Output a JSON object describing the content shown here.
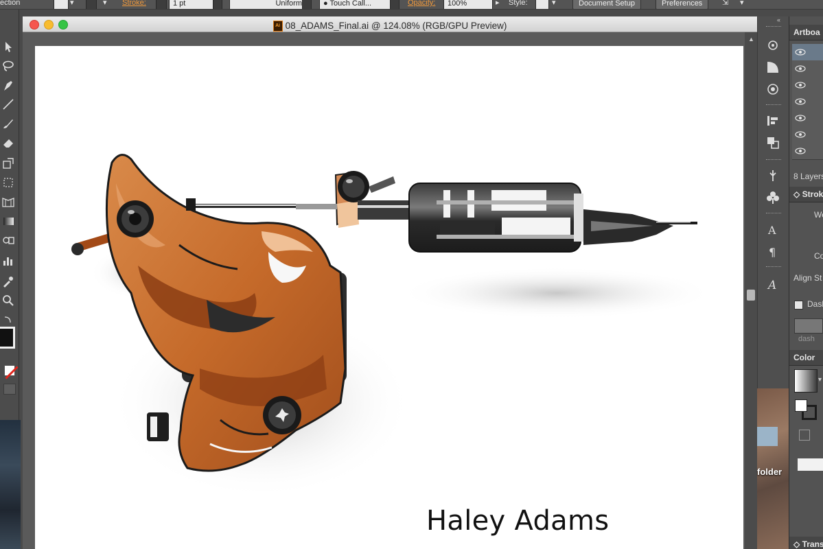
{
  "control_bar": {
    "selection_label": "ection",
    "stroke_label": "Stroke:",
    "stroke_value": "1 pt",
    "profile_label": "Uniform",
    "brush_label": "Touch Call...",
    "opacity_label": "Opacity:",
    "opacity_value": "100%",
    "style_label": "Style:",
    "document_setup_label": "Document Setup",
    "preferences_label": "Preferences"
  },
  "document": {
    "file_icon_text": "Ai",
    "title": "08_ADAMS_Final.ai @ 124.08% (RGB/GPU Preview)",
    "zoom_percent": 124.08,
    "artist_name": "Haley Adams"
  },
  "panels": {
    "artboards_tab": "Artboa",
    "layers_count": "8 Layers",
    "stroke_tab": "Stroke",
    "weight_label": "We",
    "cap_label": "Co",
    "align_stroke_label": "Align St",
    "dashed_label": "Dash",
    "dash_label": "dash",
    "color_tab": "Color",
    "transform_tab": "Trans"
  },
  "desktop": {
    "folder_label": "folder"
  },
  "tools": {
    "items": [
      "selection-tool",
      "direct-selection-tool",
      "pen-tool",
      "line-tool",
      "brush-tool",
      "eraser-tool",
      "scale-tool",
      "warp-tool",
      "shape-builder-tool",
      "gradient-tool",
      "blend-tool",
      "column-graph-tool",
      "eyedropper-tool",
      "zoom-tool"
    ]
  },
  "colors": {
    "ui_accent": "#f19a3d",
    "frame_orange": "#c8682a",
    "frame_dark": "#8c3e14",
    "tube_dark": "#2e2e2e",
    "artboard": "#ffffff"
  }
}
